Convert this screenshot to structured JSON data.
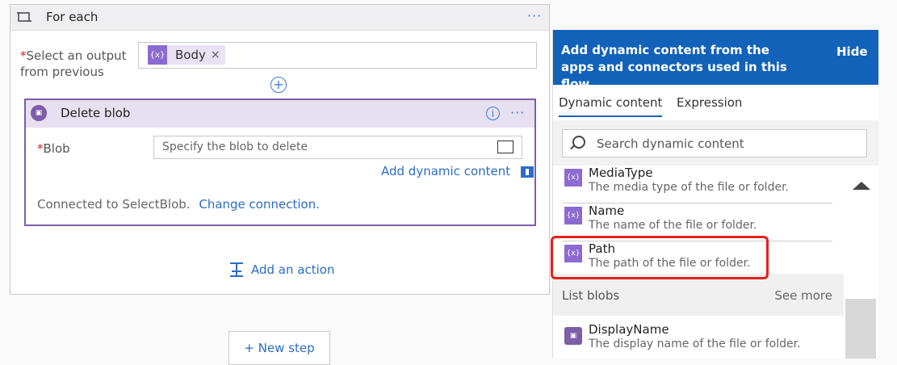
{
  "foreach": {
    "title": "For each",
    "menu": "···"
  },
  "select_output": {
    "required_mark": "*",
    "label_line1": "Select an output",
    "label_line2": "from previous",
    "token_label": "Body",
    "token_icon": "{x}",
    "token_remove": "×"
  },
  "delete_blob": {
    "title": "Delete blob",
    "menu": "···",
    "info": "i",
    "blob_required_mark": "*",
    "blob_label": "Blob",
    "blob_placeholder": "Specify the blob to delete",
    "add_dynamic_content": "Add dynamic content",
    "connected_text": "Connected to SelectBlob.",
    "change_connection": "Change connection."
  },
  "add_action": "Add an action",
  "new_step": "+ New step",
  "panel": {
    "header": "Add dynamic content from the apps and connectors used in this flow.",
    "hide": "Hide",
    "tabs": [
      "Dynamic content",
      "Expression"
    ],
    "search_placeholder": "Search dynamic content",
    "items": [
      {
        "name": "MediaType",
        "desc": "The media type of the file or folder."
      },
      {
        "name": "Name",
        "desc": "The name of the file or folder."
      },
      {
        "name": "Path",
        "desc": "The path of the file or folder."
      }
    ],
    "section": {
      "title": "List blobs",
      "see_more": "See more"
    },
    "section_items": [
      {
        "name": "DisplayName",
        "desc": "The display name of the file or folder."
      }
    ]
  },
  "colors": {
    "accent": "#1162b8",
    "purple": "#7d5ca8",
    "highlight": "#e8201c"
  }
}
